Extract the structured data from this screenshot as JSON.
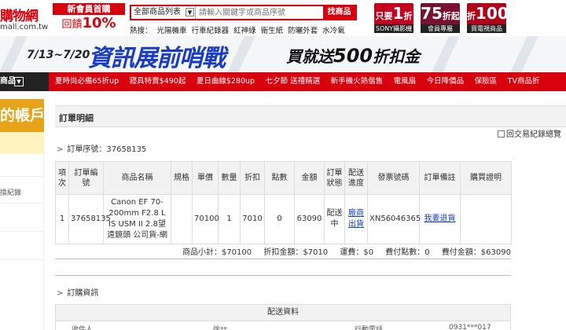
{
  "header": {
    "logo_text": "購物網",
    "logo_url": "mall.com.tw",
    "newmember_line1": "新會員首購",
    "newmember_line2_prefix": "回饋",
    "newmember_line2_value": "10%",
    "search": {
      "category": "全部商品列表",
      "placeholder": "請輸入關鍵字或商品序號",
      "button": "找商品"
    },
    "hot_label": "熱搜：",
    "hot_terms": [
      "光陽機車",
      "行車紀錄器",
      "紅神綠",
      "衛生紙",
      "防曬外套",
      "水冷氣"
    ],
    "promos": [
      {
        "top_prefix": "只要",
        "top_value": "1",
        "top_suffix": "折",
        "bottom": "SONY攝影機"
      },
      {
        "top_prefix": "",
        "top_value": "75",
        "top_suffix": "折起",
        "bottom": "會員專屬"
      },
      {
        "top_prefix": "折",
        "top_value": "100",
        "top_suffix": "",
        "bottom": "買電視商品"
      }
    ]
  },
  "banner": {
    "dates": "7/13~7/20",
    "headline": "資訊展前哨戰",
    "offer_prefix": "買就送",
    "offer_value": "500",
    "offer_suffix": "折扣金"
  },
  "nav": {
    "menu_label": "商品",
    "links": [
      "夏時尚必備65折up",
      "寢具特賣$490起",
      "夏日曲線$280up",
      "七夕節 送禮精選",
      "新手機火熱偕售",
      "電風扇",
      "今日降價品",
      "保險區",
      "TV商品折"
    ]
  },
  "sidebar": {
    "account_title": "的帳戶",
    "item_label": "換紀錄"
  },
  "main": {
    "panel_title": "訂單明細",
    "history_link": "回交易紀錄總覽",
    "order_no_label": "訂單序號：",
    "order_no": "37658135",
    "table": {
      "headers": [
        "項次",
        "訂單編號",
        "商品名稱",
        "規格",
        "單價",
        "數量",
        "折扣",
        "點數",
        "金額",
        "訂單狀態",
        "配送進度",
        "發票號碼",
        "訂單備註",
        "購買證明"
      ],
      "row": {
        "index": "1",
        "order_id": "37658135",
        "product": "Canon EF 70-200mm F2.8 L IS USM II 2.8望遠鏡頭 公司貨-網",
        "spec": "",
        "price": "70100",
        "qty": "1",
        "discount": "7010",
        "points": "0",
        "amount": "63090",
        "status": "配送中",
        "shipping": "廠商出貨",
        "invoice": "XN56046365",
        "note": "我要退貨",
        "proof": ""
      }
    },
    "summary": {
      "subtotal": "商品小計：$70100",
      "discount": "折扣金額：$7010",
      "shipping_fee": "運費：$0",
      "points": "費付點數：0",
      "total": "費付金額：$63090"
    },
    "sub_section_title": "訂購資訊",
    "shipping_bar": "配送資料",
    "shipping_row": [
      "收件人",
      "徐**",
      "行動電話",
      "0931***017"
    ]
  },
  "colors": {
    "brand_red": "#d8000c",
    "link_blue": "#1a40b8",
    "account_orange": "#e8a419"
  }
}
